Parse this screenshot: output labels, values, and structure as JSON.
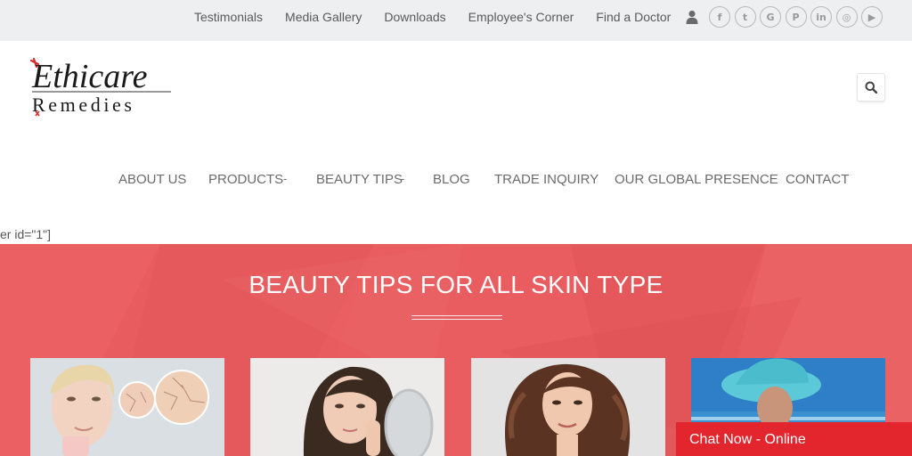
{
  "topbar": {
    "links": [
      "Testimonials",
      "Media Gallery",
      "Downloads",
      "Employee's Corner",
      "Find a Doctor"
    ],
    "social_icons": [
      "facebook-icon",
      "twitter-icon",
      "google-icon",
      "pinterest-icon",
      "linkedin-icon",
      "instagram-icon",
      "youtube-icon"
    ],
    "social_glyphs": [
      "f",
      "t",
      "G",
      "P",
      "in",
      "◎",
      "▶"
    ]
  },
  "logo": {
    "line1": "Ethicare",
    "line2": "Remedies"
  },
  "nav": {
    "items": [
      "ABOUT US",
      "PRODUCTS",
      "BEAUTY TIPS",
      "BLOG",
      "TRADE INQUIRY",
      "OUR GLOBAL PRESENCE",
      "CONTACT"
    ],
    "caret": "-"
  },
  "shortcode_text": "er id=\"1\"]",
  "hero": {
    "title": "BEAUTY TIPS FOR ALL SKIN TYPE",
    "background_color": "#e85b5e"
  },
  "chat": {
    "label": "Chat Now - Online",
    "color": "#e3262e"
  }
}
